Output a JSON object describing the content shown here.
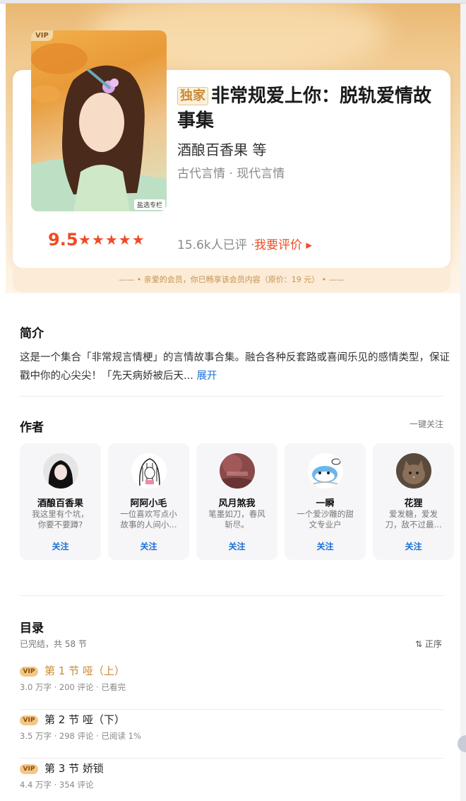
{
  "book": {
    "vip_badge": "VIP",
    "column_tag": "盐选专栏",
    "exclusive": "独家",
    "title": "非常规爱上你：脱轨爱情故事集",
    "author": "酒酿百香果 等",
    "genres": "古代言情 · 现代言情",
    "score": "9.5",
    "stars": "★★★★★",
    "star_rating": 5,
    "rating_count": "15.6k人已评 ·",
    "rate_link": "我要评价 ▸",
    "member_note": "—— • 亲爱的会员，你已畅享该会员内容（原价：19 元） • ——"
  },
  "intro": {
    "heading": "简介",
    "text": "这是一个集合「非常规言情梗」的言情故事合集。融合各种反套路或喜闻乐见的感情类型，保证戳中你的心尖尖！「先天病娇被后天...",
    "expand": "展开"
  },
  "authors": {
    "heading": "作者",
    "follow_all": "一键关注",
    "items": [
      {
        "name": "酒酿百香果",
        "desc": "我这里有个坑，你要不要蹲?",
        "follow": "关注"
      },
      {
        "name": "阿阿小毛",
        "desc": "一位喜欢写点小故事的人间小...",
        "follow": "关注"
      },
      {
        "name": "风月煞我",
        "desc": "笔墨如刀，春风斩尽。",
        "follow": "关注"
      },
      {
        "name": "一瞬",
        "desc": "一个爱沙雕的甜文专业户",
        "follow": "关注"
      },
      {
        "name": "花狸",
        "desc": "爱发糖，爱发刀，敌不过最...",
        "follow": "关注"
      }
    ]
  },
  "toc": {
    "heading": "目录",
    "meta": "已完结，共 58 节",
    "order": "⇅ 正序",
    "chapters": [
      {
        "vip": "VIP",
        "title": "第 1 节 哑（上）",
        "meta": "3.0 万字 · 200 评论 · 已看完"
      },
      {
        "vip": "VIP",
        "title": "第 2 节 哑（下）",
        "meta": "3.5 万字 · 298 评论 · 已阅读 1%"
      },
      {
        "vip": "VIP",
        "title": "第 3 节 娇锁",
        "meta": "4.4 万字 · 354 评论"
      }
    ]
  },
  "colors": {
    "accent_red": "#f04b23",
    "gold": "#c98b36",
    "link_blue": "#1a6fd6"
  }
}
